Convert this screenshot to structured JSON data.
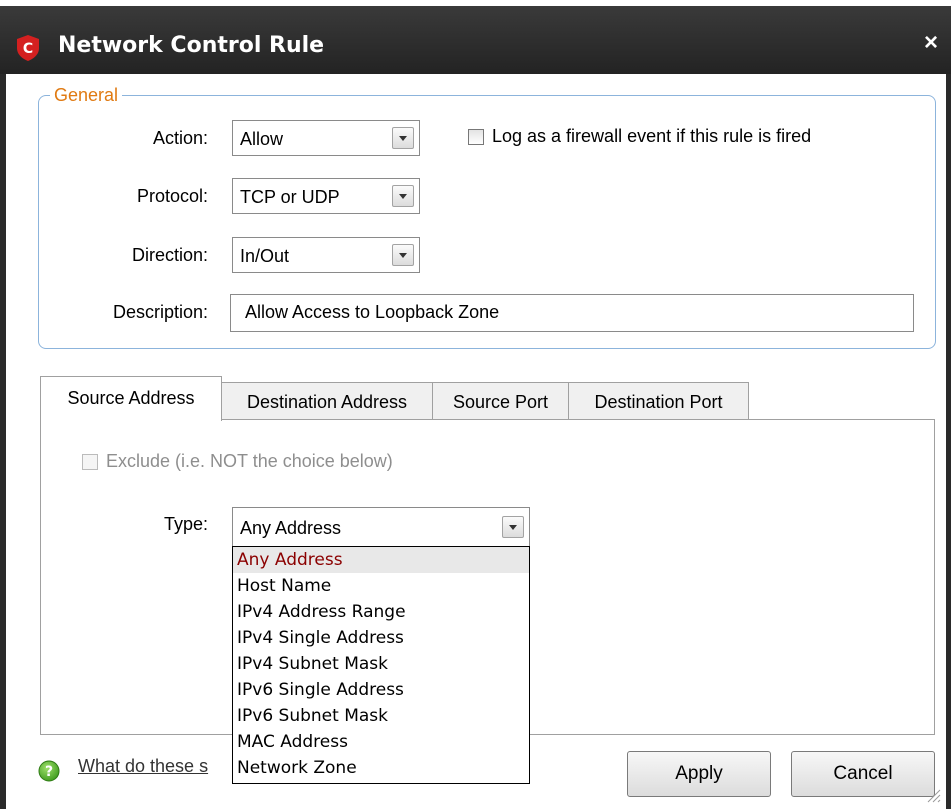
{
  "window": {
    "title": "Network Control Rule",
    "close_glyph": "×",
    "logo_letter": "C",
    "logo_color": "#d42020"
  },
  "general": {
    "legend": "General",
    "action": {
      "label": "Action:",
      "value": "Allow"
    },
    "protocol": {
      "label": "Protocol:",
      "value": "TCP or UDP"
    },
    "direction": {
      "label": "Direction:",
      "value": "In/Out"
    },
    "description": {
      "label": "Description:",
      "value": "Allow Access to Loopback Zone"
    },
    "log_checkbox": {
      "label": "Log as a firewall event if this rule is fired",
      "checked": false
    }
  },
  "tabs": [
    {
      "label": "Source Address",
      "active": true
    },
    {
      "label": "Destination Address",
      "active": false
    },
    {
      "label": "Source Port",
      "active": false
    },
    {
      "label": "Destination Port",
      "active": false
    }
  ],
  "source_address": {
    "exclude": {
      "label": "Exclude (i.e. NOT the choice below)",
      "checked": false,
      "enabled": false
    },
    "type": {
      "label": "Type:",
      "value": "Any Address",
      "options": [
        "Any Address",
        "Host Name",
        "IPv4 Address Range",
        "IPv4 Single Address",
        "IPv4 Subnet Mask",
        "IPv6 Single Address",
        "IPv6 Subnet Mask",
        "MAC Address",
        "Network Zone"
      ],
      "highlighted_index": 0
    }
  },
  "footer": {
    "help_link": "What do these s",
    "help_icon": "question-icon",
    "apply_label": "Apply",
    "cancel_label": "Cancel"
  },
  "colors": {
    "titlebar": "#2b2b2b",
    "group_border": "#8cb4dc",
    "legend": "#e07a12",
    "highlight_text": "#8b0000",
    "disabled_text": "#8e8e8e"
  }
}
